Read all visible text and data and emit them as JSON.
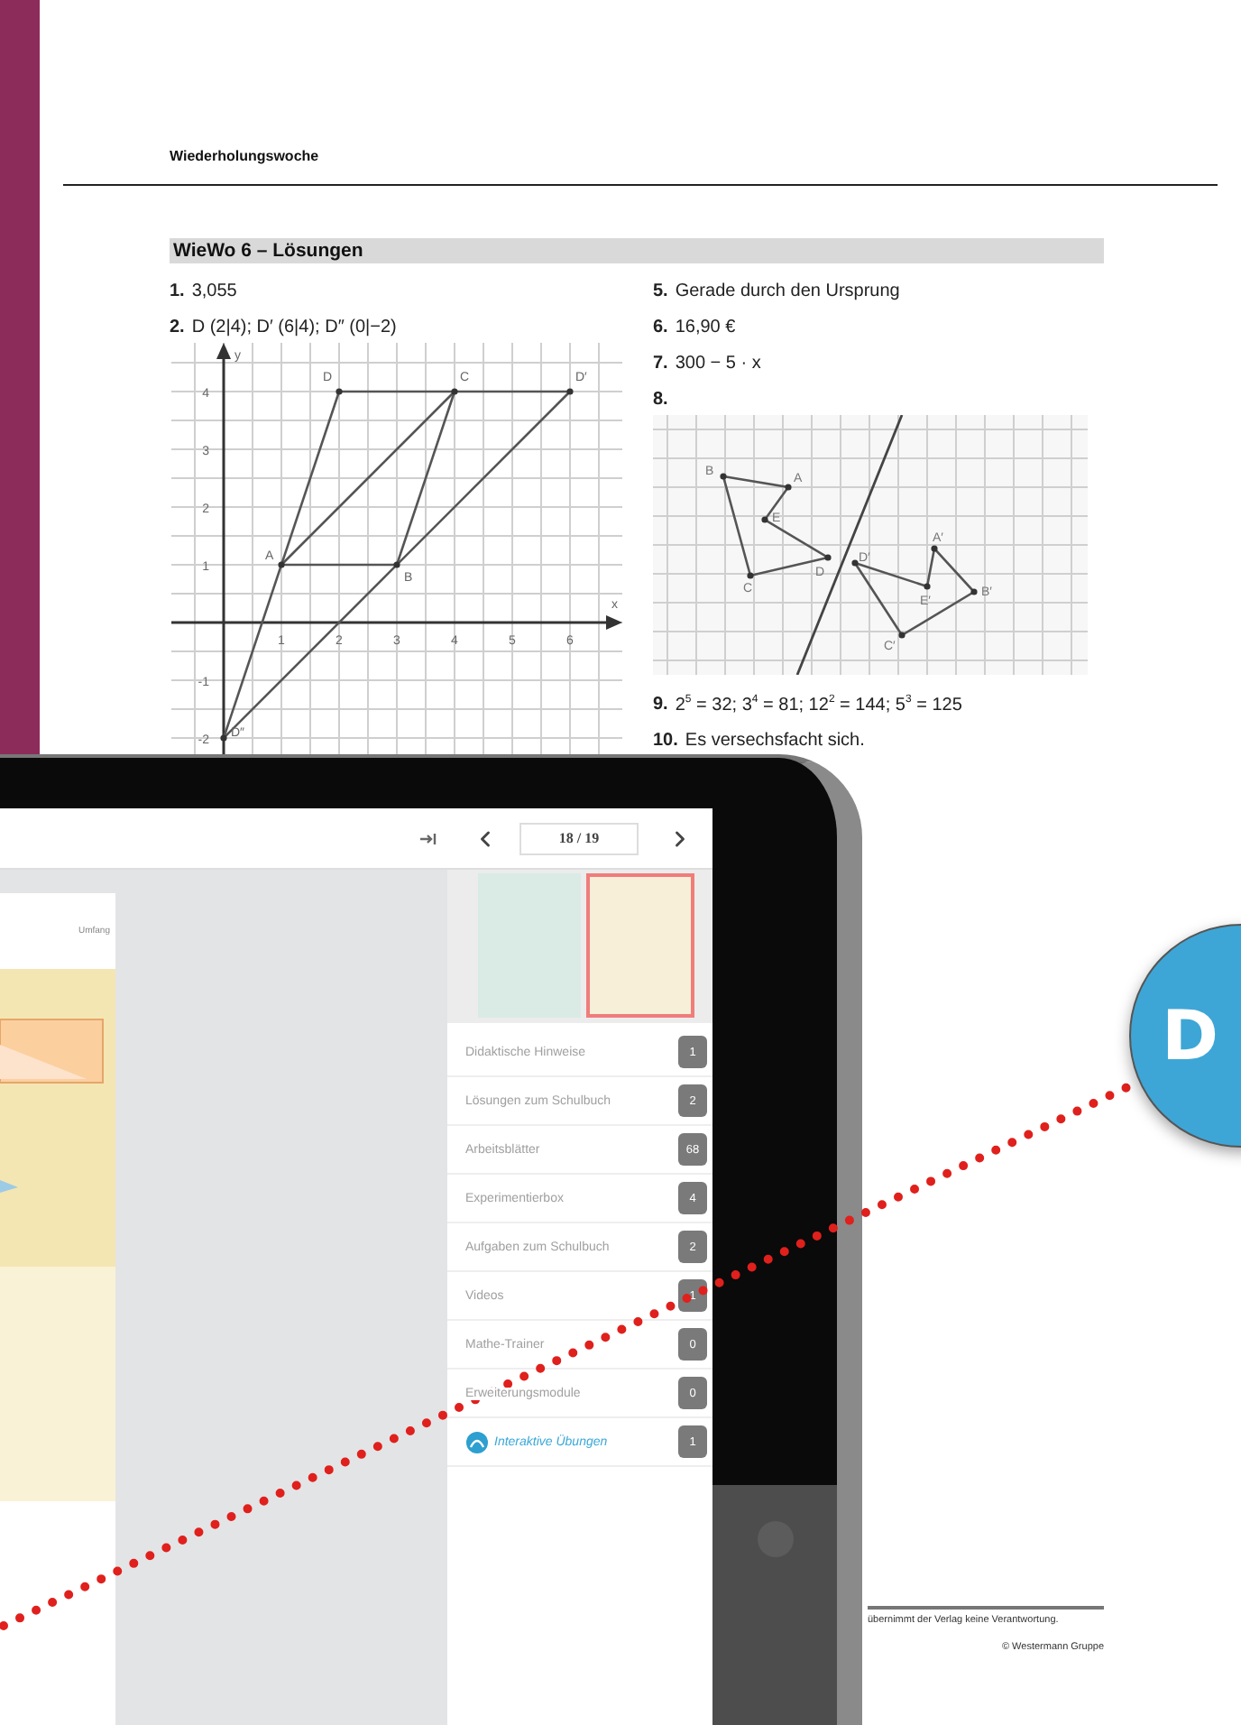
{
  "document": {
    "header": "Wiederholungswoche",
    "section_title": "WieWo 6 – Lösungen",
    "left_items": [
      {
        "number": "1.",
        "text": "3,055"
      },
      {
        "number": "2.",
        "text": "D (2|4); D′ (6|4); D″ (0|−2)",
        "figure": {
          "kind": "coordinate",
          "x_axis_label": "x",
          "y_axis_label": "y",
          "x_tick_labels": [
            "1",
            "2",
            "3",
            "4",
            "5",
            "6"
          ],
          "y_tick_labels": [
            "4",
            "3",
            "2",
            "1",
            "-1",
            "-2"
          ],
          "point_labels": [
            "D",
            "C",
            "D′",
            "A",
            "B",
            "D″"
          ]
        }
      }
    ],
    "right_items": [
      {
        "number": "5.",
        "text": "Gerade durch den Ursprung"
      },
      {
        "number": "6.",
        "text": "16,90 €"
      },
      {
        "number": "7.",
        "text": "300 − 5 · x"
      },
      {
        "number": "8.",
        "figure": {
          "kind": "grid",
          "point_labels": [
            "B",
            "A",
            "E",
            "D",
            "C",
            "D′",
            "E′",
            "A′",
            "B′",
            "C′"
          ]
        }
      },
      {
        "number": "9.",
        "text": "2$^{5}$ = 32;  3$^{4}$ = 81;  12$^{2}$ = 144;  5$^{3}$ = 125"
      },
      {
        "number": "10.",
        "text": "Es versechsfacht sich."
      }
    ],
    "footer": {
      "disclaimer": "übernimmt der Verlag keine Verantwortung.",
      "copyright": "©  Westermann Gruppe"
    }
  },
  "tablet": {
    "page_field": "18 / 19",
    "preview_caption": "Umfang",
    "thumbnails": [
      {
        "selected": false
      },
      {
        "selected": true
      }
    ],
    "materials": [
      {
        "kind": "plain",
        "label": "Didaktische Hinweise",
        "count": "1"
      },
      {
        "kind": "plain",
        "label": "Lösungen zum Schulbuch",
        "count": "2"
      },
      {
        "kind": "plain",
        "label": "Arbeitsblätter",
        "count": "68"
      },
      {
        "kind": "plain",
        "label": "Experimentierbox",
        "count": "4"
      },
      {
        "kind": "plain",
        "label": "Aufgaben zum Schulbuch",
        "count": "2"
      },
      {
        "kind": "plain",
        "label": "Videos",
        "count": "1"
      },
      {
        "kind": "plain",
        "label": "Mathe-Trainer",
        "count": "0"
      },
      {
        "kind": "plain",
        "label": "Erweiterungsmodule",
        "count": "0"
      },
      {
        "kind": "interactive",
        "label": "Interaktive Übungen",
        "count": "1"
      }
    ]
  },
  "round_badge": {
    "text": "D"
  }
}
